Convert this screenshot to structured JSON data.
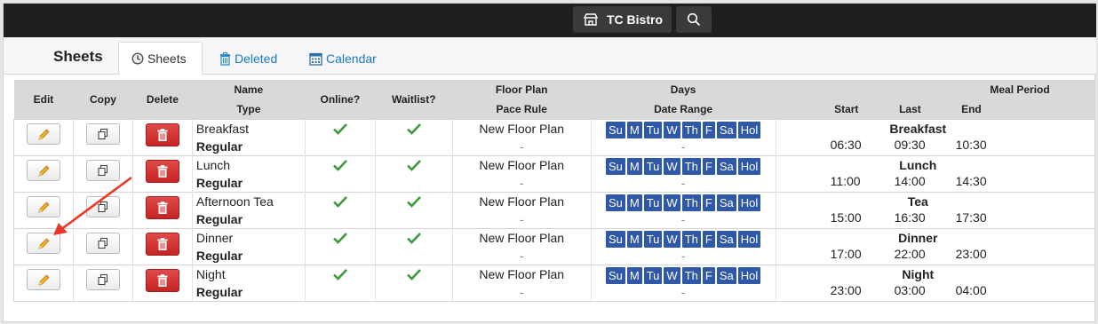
{
  "topbar": {
    "venue": "TC Bistro",
    "venue_icon": "store-icon",
    "search_icon": "search-icon"
  },
  "page": {
    "title": "Sheets"
  },
  "tabs": [
    {
      "label": "Sheets",
      "icon": "clock-icon"
    },
    {
      "label": "Deleted",
      "icon": "trash-icon"
    },
    {
      "label": "Calendar",
      "icon": "calendar-icon"
    }
  ],
  "headers": {
    "edit": "Edit",
    "copy": "Copy",
    "delete": "Delete",
    "name": "Name",
    "type": "Type",
    "online": "Online?",
    "waitlist": "Waitlist?",
    "floor_plan": "Floor Plan",
    "pace_rule": "Pace Rule",
    "days": "Days",
    "date_range": "Date Range",
    "meal_period": "Meal Period",
    "start": "Start",
    "last": "Last",
    "end": "End"
  },
  "days": [
    "Su",
    "M",
    "Tu",
    "W",
    "Th",
    "F",
    "Sa",
    "Hol"
  ],
  "colors": {
    "day_badge": "#2f58a8",
    "delete_button": "#d03535",
    "check": "#3c9a3c",
    "arrow": "#e8382a"
  },
  "rows": [
    {
      "name": "Breakfast",
      "type": "Regular",
      "floor_plan": "New Floor Plan",
      "pace_rule": "-",
      "date_range": "-",
      "meal": "Breakfast",
      "start": "06:30",
      "last": "09:30",
      "end": "10:30"
    },
    {
      "name": "Lunch",
      "type": "Regular",
      "floor_plan": "New Floor Plan",
      "pace_rule": "-",
      "date_range": "-",
      "meal": "Lunch",
      "start": "11:00",
      "last": "14:00",
      "end": "14:30"
    },
    {
      "name": "Afternoon Tea",
      "type": "Regular",
      "floor_plan": "New Floor Plan",
      "pace_rule": "-",
      "date_range": "-",
      "meal": "Tea",
      "start": "15:00",
      "last": "16:30",
      "end": "17:30"
    },
    {
      "name": "Dinner",
      "type": "Regular",
      "floor_plan": "New Floor Plan",
      "pace_rule": "-",
      "date_range": "-",
      "meal": "Dinner",
      "start": "17:00",
      "last": "22:00",
      "end": "23:00"
    },
    {
      "name": "Night",
      "type": "Regular",
      "floor_plan": "New Floor Plan",
      "pace_rule": "-",
      "date_range": "-",
      "meal": "Night",
      "start": "23:00",
      "last": "03:00",
      "end": "04:00"
    }
  ]
}
